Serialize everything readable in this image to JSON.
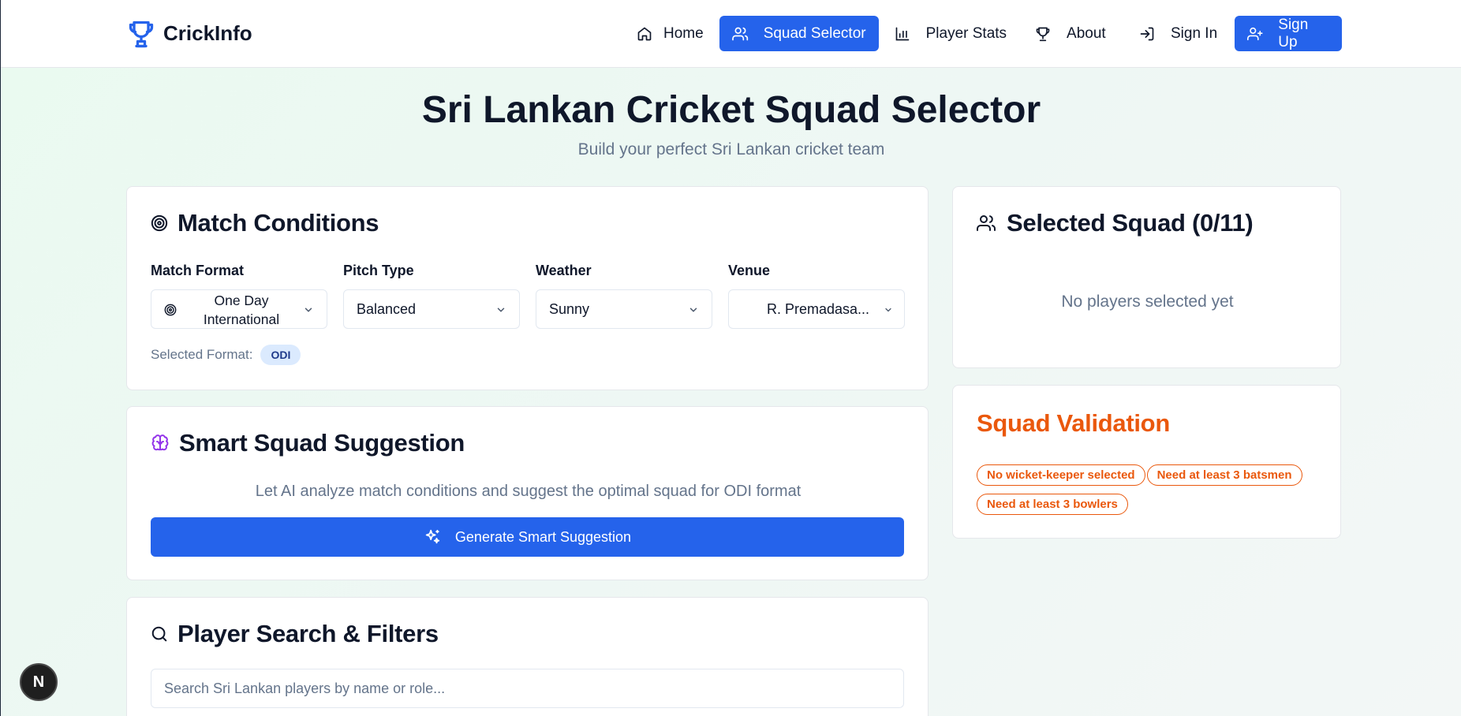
{
  "brand": {
    "name": "CrickInfo"
  },
  "nav": {
    "items": [
      {
        "label": "Home",
        "icon": "home-icon"
      },
      {
        "label": "Squad Selector",
        "icon": "users-icon",
        "active": true
      },
      {
        "label": "Player Stats",
        "icon": "bar-chart-icon"
      },
      {
        "label": "About",
        "icon": "trophy-icon"
      }
    ],
    "sign_in": "Sign In",
    "sign_up": "Sign Up"
  },
  "page": {
    "title": "Sri Lankan Cricket Squad Selector",
    "subtitle": "Build your perfect Sri Lankan cricket team"
  },
  "match_conditions": {
    "title": "Match Conditions",
    "format_label": "Match Format",
    "format_value": "One Day International",
    "pitch_label": "Pitch Type",
    "pitch_value": "Balanced",
    "weather_label": "Weather",
    "weather_value": "Sunny",
    "venue_label": "Venue",
    "venue_value": "R. Premadasa...",
    "selected_format_label": "Selected Format:",
    "selected_format_badge": "ODI"
  },
  "smart_suggestion": {
    "title": "Smart Squad Suggestion",
    "description": "Let AI analyze match conditions and suggest the optimal squad for ODI format",
    "button_label": "Generate Smart Suggestion"
  },
  "player_search": {
    "title": "Player Search & Filters",
    "placeholder": "Search Sri Lankan players by name or role..."
  },
  "selected_squad": {
    "title": "Selected Squad (0/11)",
    "empty_text": "No players selected yet"
  },
  "validation": {
    "title": "Squad Validation",
    "issues": [
      "No wicket-keeper selected",
      "Need at least 3 batsmen",
      "Need at least 3 bowlers"
    ]
  },
  "dev_badge": {
    "label": "N"
  },
  "colors": {
    "accent": "#2563eb",
    "warning": "#ea580c",
    "text": "#0f172a",
    "muted": "#64748b",
    "ai_purple": "#9333ea"
  }
}
